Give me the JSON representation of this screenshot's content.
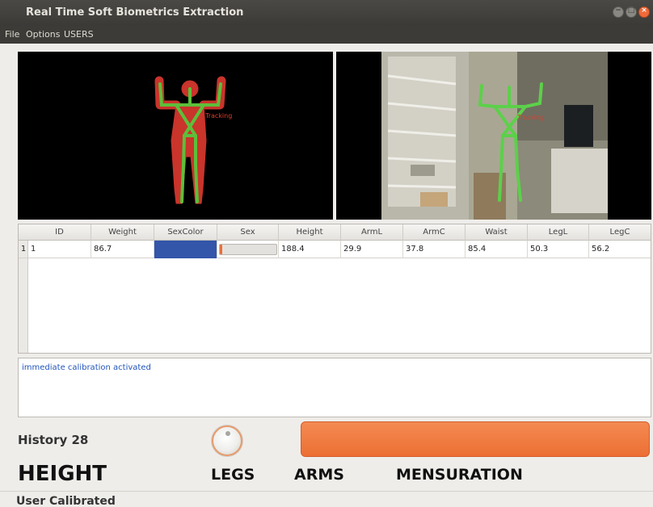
{
  "window": {
    "title": "Real Time Soft Biometrics Extraction",
    "buttons": [
      "−",
      "□",
      "×"
    ]
  },
  "menu": [
    "File",
    "Options",
    "USERS"
  ],
  "views": {
    "depth_label": "Tracking",
    "rgb_label": "Tracking"
  },
  "table": {
    "columns": [
      "ID",
      "Weight",
      "SexColor",
      "Sex",
      "Height",
      "ArmL",
      "ArmC",
      "Waist",
      "LegL",
      "LegC"
    ],
    "rows": [
      {
        "row_number": "1",
        "id": "1",
        "weight": "86.7",
        "sex_color": "#3355aa",
        "sex_level": 0.04,
        "height": "188.4",
        "arm_l": "29.9",
        "arm_c": "37.8",
        "waist": "85.4",
        "leg_l": "50.3",
        "leg_c": "56.2"
      }
    ]
  },
  "log": {
    "message": "immediate calibration activated"
  },
  "history": "History 28",
  "progress_color": "#ee7438",
  "labels": {
    "height": "HEIGHT",
    "legs": "LEGS",
    "arms": "ARMS",
    "mensuration": "MENSURATION"
  },
  "status": "User Calibrated"
}
